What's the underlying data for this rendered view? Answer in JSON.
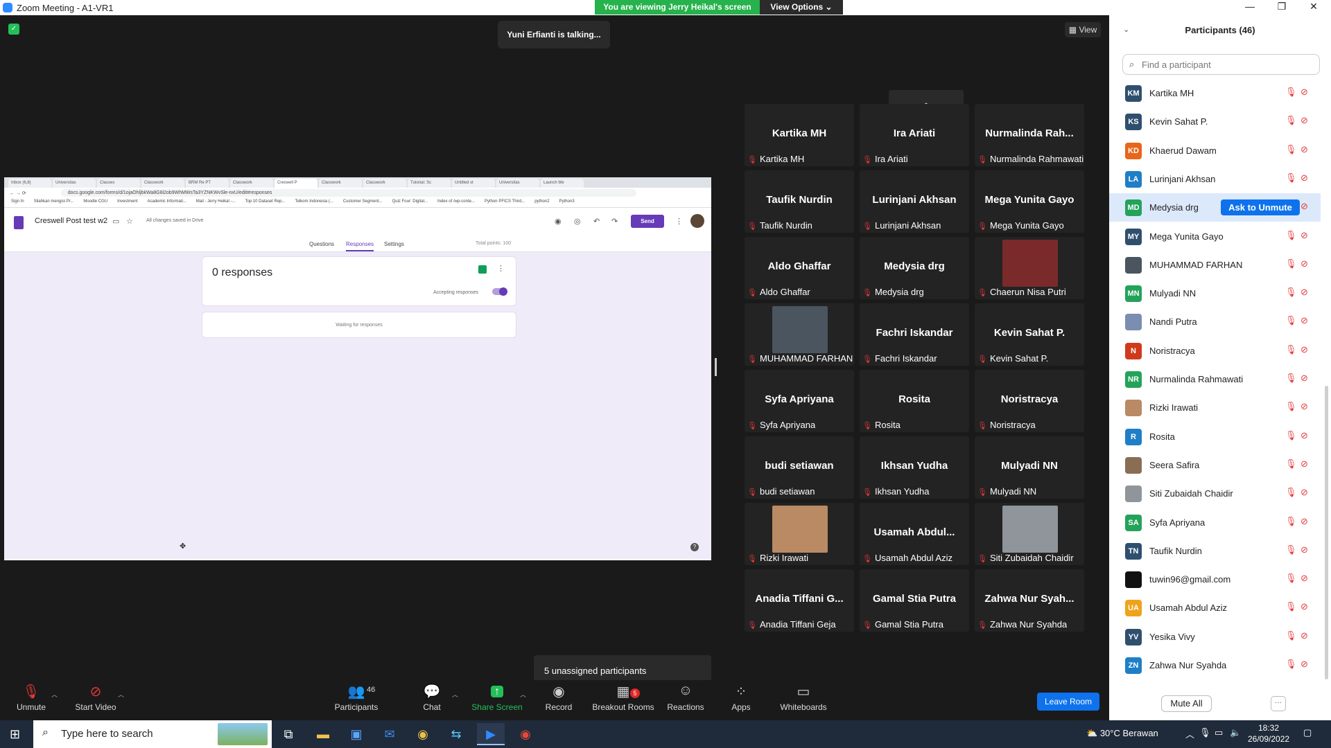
{
  "window": {
    "title": "Zoom Meeting - A1-VR1",
    "minimize": "—",
    "maximize": "❐",
    "close": "✕"
  },
  "banner": {
    "viewing": "You are viewing Jerry Heikal's screen",
    "view_options": "View Options ⌄"
  },
  "meeting": {
    "talking": "Yuni Erfianti is talking...",
    "view_label": "View",
    "scroll_up": "︿",
    "unassigned": "5 unassigned participants"
  },
  "shared_screen": {
    "tabs": [
      "Inbox (6,8)",
      "Universitas",
      "Classes",
      "Classwork",
      "BRM Re PT",
      "Classwork",
      "Creswell P",
      "Classwork",
      "Classwork",
      "Tutorial: Sc",
      "Untitled st",
      "Universitas",
      "Launch Me"
    ],
    "url": "docs.google.com/forms/d/1ojaOhljbkWa8G8i2ob9WhMWsTa3YZNKWvSle-nxU/edit#responses",
    "bookmarks": [
      "Sign In",
      "Silahkan mengisi Pr...",
      "Moodle CGU",
      "Investment",
      "Academic Informati...",
      "Mail - Jerry Heikal -...",
      "Top 10 Dataset Rep...",
      "Telkom Indonesia (...",
      "Customer Segment...",
      "Quiz Four: Digital...",
      "Index of /wp-conte...",
      "Python PFICS Third...",
      "python2",
      "Python3"
    ],
    "doc_title": "Creswell Post test w2",
    "saved": "All changes saved in Drive",
    "send": "Send",
    "tabs_form": {
      "questions": "Questions",
      "responses": "Responses",
      "settings": "Settings",
      "total_points": "Total points: 100"
    },
    "responses_count": "0 responses",
    "accepting": "Accepting responses",
    "waiting": "Waiting for responses"
  },
  "gallery": [
    {
      "big": "Kartika MH",
      "label": "Kartika MH",
      "photo": false
    },
    {
      "big": "Ira Ariati",
      "label": "Ira Ariati",
      "photo": false
    },
    {
      "big": "Nurmalinda  Rah...",
      "label": "Nurmalinda Rahmawati",
      "photo": false
    },
    {
      "big": "Taufik Nurdin",
      "label": "Taufik Nurdin",
      "photo": false
    },
    {
      "big": "Lurinjani Akhsan",
      "label": "Lurinjani Akhsan",
      "photo": false
    },
    {
      "big": "Mega Yunita Gayo",
      "label": "Mega Yunita Gayo",
      "photo": false
    },
    {
      "big": "Aldo Ghaffar",
      "label": "Aldo Ghaffar",
      "photo": false
    },
    {
      "big": "Medysia drg",
      "label": "Medysia drg",
      "photo": false
    },
    {
      "big": "",
      "label": "Chaerun Nisa Putri",
      "photo": true,
      "photo_color": "#7a2a2a"
    },
    {
      "big": "",
      "label": "MUHAMMAD FARHAN",
      "photo": true,
      "photo_color": "#4a5560"
    },
    {
      "big": "Fachri Iskandar",
      "label": "Fachri Iskandar",
      "photo": false
    },
    {
      "big": "Kevin Sahat P.",
      "label": "Kevin Sahat P.",
      "photo": false
    },
    {
      "big": "Syfa Apriyana",
      "label": "Syfa Apriyana",
      "photo": false
    },
    {
      "big": "Rosita",
      "label": "Rosita",
      "photo": false
    },
    {
      "big": "Noristracya",
      "label": "Noristracya",
      "photo": false
    },
    {
      "big": "budi setiawan",
      "label": "budi setiawan",
      "photo": false
    },
    {
      "big": "Ikhsan Yudha",
      "label": "Ikhsan Yudha",
      "photo": false
    },
    {
      "big": "Mulyadi NN",
      "label": "Mulyadi NN",
      "photo": false
    },
    {
      "big": "",
      "label": "Rizki Irawati",
      "photo": true,
      "photo_color": "#b98a63"
    },
    {
      "big": "Usamah  Abdul...",
      "label": "Usamah Abdul Aziz",
      "photo": false
    },
    {
      "big": "",
      "label": "Siti Zubaidah Chaidir",
      "photo": true,
      "photo_color": "#8f959a"
    },
    {
      "big": "Anadia  Tiffani  G...",
      "label": "Anadia Tiffani Geja",
      "photo": false
    },
    {
      "big": "Gamal Stia Putra",
      "label": "Gamal Stia Putra",
      "photo": false
    },
    {
      "big": "Zahwa  Nur  Syah...",
      "label": "Zahwa Nur Syahda",
      "photo": false
    }
  ],
  "toolbar": {
    "unmute": "Unmute",
    "start_video": "Start Video",
    "participants": "Participants",
    "participants_count": "46",
    "chat": "Chat",
    "share_screen": "Share Screen",
    "record": "Record",
    "breakout": "Breakout Rooms",
    "breakout_badge": "5",
    "reactions": "Reactions",
    "apps": "Apps",
    "whiteboards": "Whiteboards",
    "leave": "Leave Room"
  },
  "panel": {
    "title": "Participants (46)",
    "search_placeholder": "Find a participant",
    "ask_to_unmute": "Ask to Unmute",
    "mute_all": "Mute All",
    "more": "···",
    "participants": [
      {
        "initials": "KM",
        "name": "Kartika MH",
        "color": "#2f4f6f"
      },
      {
        "initials": "KS",
        "name": "Kevin Sahat P.",
        "color": "#2f4f6f"
      },
      {
        "initials": "KD",
        "name": "Khaerud Dawam",
        "color": "#e8651a"
      },
      {
        "initials": "LA",
        "name": "Lurinjani Akhsan",
        "color": "#1e7fc6"
      },
      {
        "initials": "MD",
        "name": "Medysia drg",
        "color": "#23a35a"
      },
      {
        "initials": "MY",
        "name": "Mega Yunita Gayo",
        "color": "#2f4f6f"
      },
      {
        "initials": "",
        "name": "MUHAMMAD FARHAN",
        "color": "#4a5560"
      },
      {
        "initials": "MN",
        "name": "Mulyadi NN",
        "color": "#23a35a"
      },
      {
        "initials": "",
        "name": "Nandi Putra",
        "color": "#7b8db0"
      },
      {
        "initials": "N",
        "name": "Noristracya",
        "color": "#d03a1c"
      },
      {
        "initials": "NR",
        "name": "Nurmalinda Rahmawati",
        "color": "#23a35a"
      },
      {
        "initials": "",
        "name": "Rizki Irawati",
        "color": "#b98a63"
      },
      {
        "initials": "R",
        "name": "Rosita",
        "color": "#1e7fc6"
      },
      {
        "initials": "",
        "name": "Seera Safira",
        "color": "#8a6d55"
      },
      {
        "initials": "",
        "name": "Siti Zubaidah Chaidir",
        "color": "#8f959a"
      },
      {
        "initials": "SA",
        "name": "Syfa Apriyana",
        "color": "#23a35a"
      },
      {
        "initials": "TN",
        "name": "Taufik Nurdin",
        "color": "#2f4f6f"
      },
      {
        "initials": "",
        "name": "tuwin96@gmail.com",
        "color": "#111111"
      },
      {
        "initials": "UA",
        "name": "Usamah Abdul Aziz",
        "color": "#f0a21c"
      },
      {
        "initials": "YV",
        "name": "Yesika Vivy",
        "color": "#2f4f6f"
      },
      {
        "initials": "ZN",
        "name": "Zahwa Nur Syahda",
        "color": "#1e7fc6"
      }
    ]
  },
  "taskbar": {
    "search_placeholder": "Type here to search",
    "weather": "30°C  Berawan",
    "time": "18:32",
    "date": "26/09/2022"
  }
}
